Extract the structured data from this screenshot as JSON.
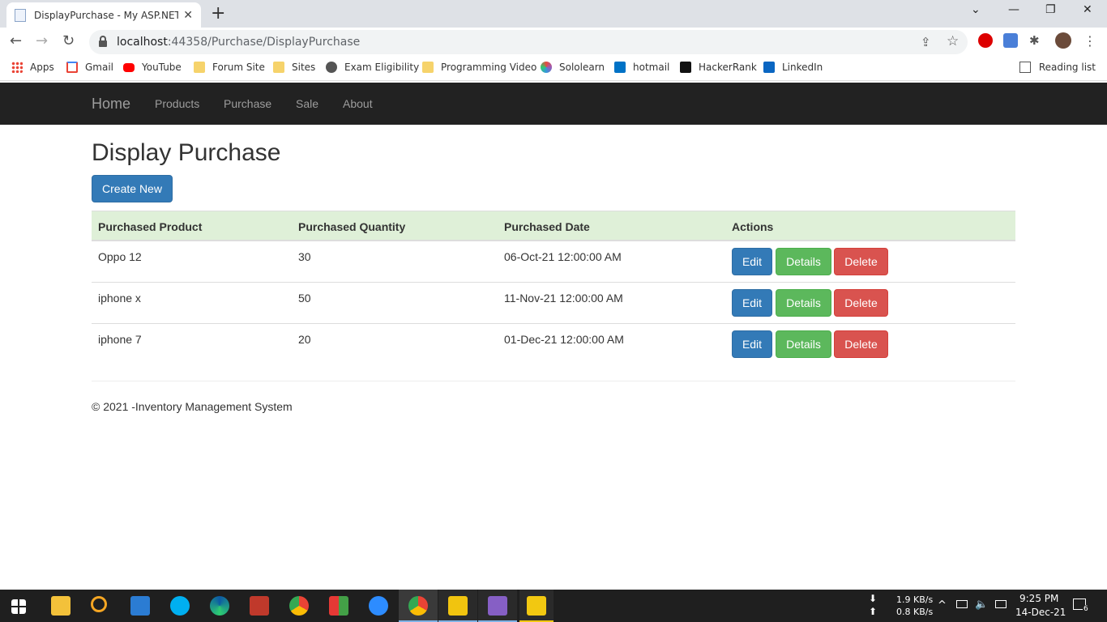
{
  "browser": {
    "tab_title": "DisplayPurchase - My ASP.NET A",
    "tab_close": "✕",
    "new_tab": "+",
    "url_host": "localhost",
    "url_path": ":44358/Purchase/DisplayPurchase",
    "win_minimize": "—",
    "win_restore": "❐",
    "win_close": "✕",
    "tab_list": "⌄",
    "back": "←",
    "forward": "→",
    "reload": "↻",
    "menu": "⋮",
    "share": "⇪",
    "star": "☆",
    "puzzle": "✱"
  },
  "bookmarks": [
    {
      "label": "Apps",
      "icon": "apps-grid-icon",
      "color": "#ea4335"
    },
    {
      "label": "Gmail",
      "icon": "gmail-icon",
      "color": "#ea4335"
    },
    {
      "label": "YouTube",
      "icon": "youtube-icon",
      "color": "#ff0000"
    },
    {
      "label": "Forum Site",
      "icon": "folder-icon",
      "color": "#f6d36b"
    },
    {
      "label": "Sites",
      "icon": "folder-icon",
      "color": "#f6d36b"
    },
    {
      "label": "Exam Eligibility",
      "icon": "globe-icon",
      "color": "#555555"
    },
    {
      "label": "Programming Video",
      "icon": "folder-icon",
      "color": "#f6d36b"
    },
    {
      "label": "Sololearn",
      "icon": "sololearn-icon",
      "color": "#9b59b6"
    },
    {
      "label": "hotmail",
      "icon": "outlook-icon",
      "color": "#0072c6"
    },
    {
      "label": "HackerRank",
      "icon": "hackerrank-icon",
      "color": "#111111"
    },
    {
      "label": "LinkedIn",
      "icon": "linkedin-icon",
      "color": "#0a66c2"
    }
  ],
  "reading_list": "Reading list",
  "nav": {
    "brand": "Home",
    "links": [
      "Products",
      "Purchase",
      "Sale",
      "About"
    ]
  },
  "page": {
    "title": "Display Purchase",
    "create_label": "Create New"
  },
  "table": {
    "headers": [
      "Purchased Product",
      "Purchased Quantity",
      "Purchased Date",
      "Actions"
    ],
    "rows": [
      {
        "product": "Oppo 12",
        "quantity": "30",
        "date": "06-Oct-21 12:00:00 AM"
      },
      {
        "product": "iphone x",
        "quantity": "50",
        "date": "11-Nov-21 12:00:00 AM"
      },
      {
        "product": "iphone 7",
        "quantity": "20",
        "date": "01-Dec-21 12:00:00 AM"
      }
    ],
    "actions": {
      "edit": "Edit",
      "details": "Details",
      "delete": "Delete"
    }
  },
  "footer": "© 2021 -Inventory Management System",
  "taskbar": {
    "net_down": "1.9 KB/s",
    "net_up": "0.8 KB/s",
    "time": "9:25 PM",
    "date": "14-Dec-21",
    "notifications": "6"
  },
  "colors": {
    "primary": "#337ab7",
    "success": "#5cb85c",
    "danger": "#d9534f",
    "table_header": "#dff0d8",
    "navbar": "#222222"
  }
}
